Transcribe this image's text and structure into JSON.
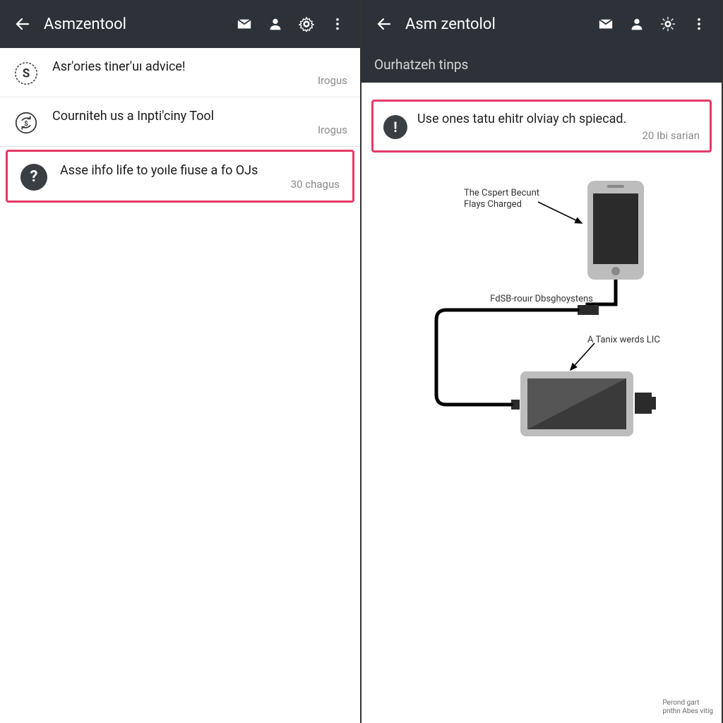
{
  "colors": {
    "appbar": "#2c3238",
    "highlight": "#e53968"
  },
  "left": {
    "appbar": {
      "title": "Asmzentool"
    },
    "items": [
      {
        "icon": "circle-s",
        "title": "Asr'ories tiner'uı advice!",
        "sub": "Irogus"
      },
      {
        "icon": "sync-circle",
        "title": "Courniteh us a Inpti'ciny Tool",
        "sub": "Irogus"
      },
      {
        "icon": "question-dark",
        "title": "Asse ihfo life to yoıle fiuse a fo OJs",
        "sub": "30 chagus"
      }
    ],
    "highlighted_index": 2
  },
  "right": {
    "appbar": {
      "title": "Asm zentolol"
    },
    "subheader": "Ourhatzeh tinps",
    "tip": {
      "title": "Use ones tatu ehitr olviay ch spiecad.",
      "sub": "20 Ibi sarian"
    },
    "diagram_labels": {
      "phone_top": "The Cspert Becunt\nFlays Charged",
      "cable_mid": "FdSB-rouır Dbsghoystens",
      "phone_bottom": "A Tanix werds LIC"
    },
    "footer": "Perond gart\npnthn Abes vitig"
  }
}
